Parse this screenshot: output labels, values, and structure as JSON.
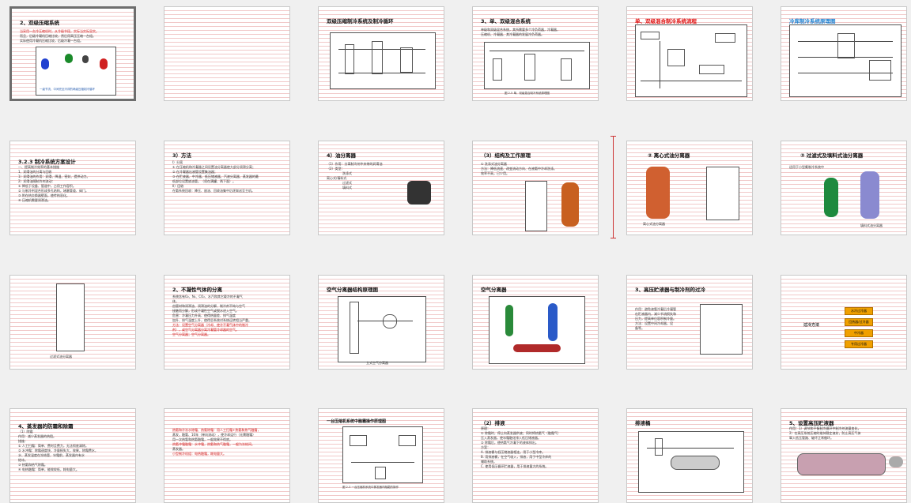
{
  "slides": [
    {
      "title": "2、双级压缩系统",
      "body": [
        "当采用一台冷压缩机时，从冷级节段，实际当实际显实。",
        "而且，后级冷凝机压缩比较，然后用高压压缩一台组。",
        "     实际使用冷凝机压缩比较，后级冷凝一台组。"
      ],
      "caption": "一级节流、中间完全冷却的两级压缩制冷循环"
    },
    {
      "title": "",
      "body": []
    },
    {
      "title": "双级压缩制冷系统及制冷循环",
      "body": []
    },
    {
      "title": "3、单、双级混合系统",
      "body": [
        "  单级和双级混合系统，其所需要多个冷负荷器，冷凝器，",
        "  压缩机、冷凝器、其冷凝器的发展冷负荷器。"
      ],
      "caption": "图 2-5  单、双级混合制冷系统原理图"
    },
    {
      "title": "单、双级混合制冷系统流程",
      "body": []
    },
    {
      "title": "冷库制冷系统原理图",
      "body": []
    },
    {
      "title": "3.2.3 制冷系统方案设计",
      "body": [
        "一、提高制冷效率的基本措施",
        "1、润滑油的分离与回收",
        "  1）润滑油的作用：润滑、降温、密封、提供动力。",
        "  2）润滑油随制冷剂流动：",
        "  ①  降低于设备、管道中，占用工作容积。",
        "  ②  与制冷剂混合形成多孔结构，堵塞管道、阀门。",
        "  ③  附在热交换器壁面，使传热恶化。",
        "  ④  压缩机需要润滑油。"
      ]
    },
    {
      "title": "3）方法",
      "body": [
        "  I）分离",
        "     ①  在压缩机和冷凝器之间设置油分离器使大部分润滑分离；",
        "     ②  在冷凝器出液管设置集油器；",
        "     ③  在贮液器、中冷器、低压储液器、汽液分离器、蒸发器的最",
        "        低部位设置放油管。（须在满罐、两下面）。",
        "  II）回收",
        "     在氨系统回收：降压、放油、回收油集中后逐渐送至主机。"
      ]
    },
    {
      "title": "4）油分离器",
      "body": [
        "（1）作用：分离制冷剂中夹带的润滑油",
        "（2）类型："
      ],
      "tags": [
        "洗涤式",
        "离心式/填料式",
        "过滤式",
        "填料式",
        "填料式"
      ]
    },
    {
      "title": "（3）结构及工作原理",
      "body": [
        "①  洗涤式油分离器",
        "  方法：降低流速、改变流动方向、在液氨中冷却洗涤。",
        "  效率不高，已少用。"
      ],
      "caption": "洗涤式油分离器"
    },
    {
      "title": "②  离心式油分离器",
      "body": [],
      "caption": "离心式油分离器"
    },
    {
      "title": "③  过滤式及填料式油分离器",
      "body": [
        "  适用于小型氟制冷系统中"
      ],
      "caption": "填料式油分离器"
    },
    {
      "title": "",
      "body": [],
      "caption": "过滤式油分离器"
    },
    {
      "title": "2、不凝性气体的分离",
      "body": [
        "  系统含有O₂、N₂、CO₂、水汽和其它载冷的不凝气",
        "体。",
        "  由管材和润滑油、润滑油的分解、制冷剂不纯与空气",
        "接触而分解，形成不凝性空气或脱水进入空气。",
        "  危害：冷凝压力升高、使得热量差、排气温度",
        "加升、排气温度上升，使得总系统对系统运转相当严重。",
        "  方法：设置空气分离器（冷却、使冷不凝气体中的制冷",
        "剂），或空气分离器分离冷凝管冷却器的空气。",
        "  空气分离器；空气分离器。"
      ]
    },
    {
      "title": "空气分离器结构原理图",
      "body": [],
      "caption": "立式空气分离器"
    },
    {
      "title": "空气分离器",
      "body": []
    },
    {
      "title": "3、高压贮液器与制冷剂的过冷",
      "body": [
        "作用：避免液氨冷凝后冷凝管",
        "  在贮液器内，减少节流损失和",
        "  压力，提高单位容积制冷量。",
        "方法：设置中间冷却器，设",
        "  备等。"
      ]
    },
    {
      "title": "",
      "body": [],
      "label": "过冷方法",
      "options": [
        "水冷过冷器",
        "回热器/过冷器",
        "中冷器",
        "专用过冷器"
      ]
    },
    {
      "title": "4、蒸发器的防霜和除霜",
      "body": [
        "（1）除霜",
        "  作用：减少蒸发器的热阻。",
        "  措施：",
        "  ①  人工扫霜：简单、费时且费力，无法彻底清除。",
        "  ②  水冲霜：除霜速度快，冷量损失大，效果，除霜费水，",
        "     水、蒸发温度在冻结管，冰霜前，蒸发器内有水",
        "     结冰。",
        "  ③  热氨和热气除霜。",
        "  ④  电热融霜：简单，能效较低，耗电量大。"
      ]
    },
    {
      "title": "",
      "body": [
        "热氨和冷冻水除霜、热氨除霜：用人工扫霜+热氨和热气融霜，",
        "  蒸发，融氨、10年（单向流动），使冷却运行（无需融霜）",
        "  用一次热氨和热氨融霜，一般效果不彻底。",
        "",
        "  热氨冲霜融霜：水冲霜，热氨和热气融霜，一般为冻结间。",
        "  蒸发器。",
        "",
        "  小型制冷机组：电热融霜，耗电量大。"
      ],
      "red_lines": [
        0,
        4,
        7
      ]
    },
    {
      "title": "一台压缩机系统中融霜操作原理图",
      "body": [],
      "caption": "图 2-3  一台压缩机系统中蒸发器内融霜的操作"
    },
    {
      "title": "（2）排液",
      "body": [
        "原理：",
        "  ①  除霜时，停止向蒸发器供液；同时将热氨气（融霜气）",
        "     压入蒸发器，使冰霜融化排入低压储液器。",
        "  ②  除霜后，使热氨气冷凝下的液体排出。",
        "方案：",
        "  A.  排液桶与低压储液器相连，用于小型冷库。",
        "  B.  用排液桶，在空气吸入，排液，用于中型冷库的",
        "     辅助系统。",
        "  C.  使用低压循环贮液器，用于排液量大的系统。"
      ]
    },
    {
      "title": "排液桶",
      "body": []
    },
    {
      "title": "5、设置高压贮液器",
      "body": [
        "作用：1）调节和平衡制冷循环中制冷剂流量变化，",
        "  2）在高压系统压缩时维持稳定液封，防止高压气体",
        "  窜入低压管路、破坏正常循环。"
      ]
    }
  ]
}
